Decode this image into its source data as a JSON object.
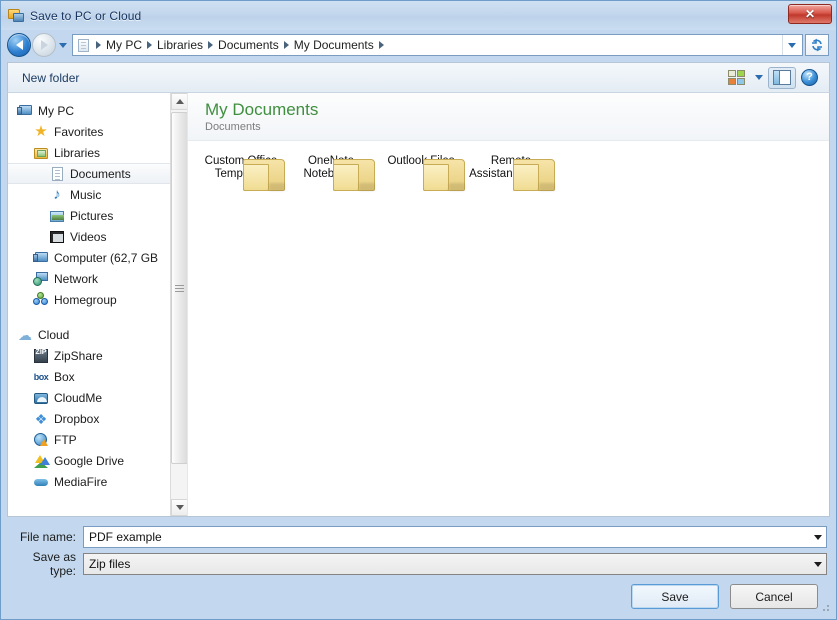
{
  "window": {
    "title": "Save to PC or Cloud",
    "title_icon": "folder-computer-icon",
    "close_label": "✕"
  },
  "address_bar": {
    "back_icon": "back-arrow-icon",
    "forward_icon": "forward-arrow-icon",
    "history_icon": "chevron-down-icon",
    "path_icon": "documents-icon",
    "crumbs": [
      "My PC",
      "Libraries",
      "Documents",
      "My Documents"
    ],
    "separator": "›",
    "dropdown_icon": "chevron-down-icon",
    "refresh_icon": "refresh-icon"
  },
  "toolbar": {
    "new_folder_label": "New folder",
    "views_icon": "views-grid-icon",
    "views_caret_icon": "chevron-down-icon",
    "preview_pane_icon": "preview-pane-icon",
    "help_icon": "help-icon",
    "help_glyph": "?"
  },
  "sidebar": {
    "items": [
      {
        "label": "My PC",
        "icon": "computer-icon",
        "indent": 0,
        "selected": false
      },
      {
        "label": "Favorites",
        "icon": "star-icon",
        "indent": 1,
        "selected": false
      },
      {
        "label": "Libraries",
        "icon": "libraries-icon",
        "indent": 1,
        "selected": false
      },
      {
        "label": "Documents",
        "icon": "documents-icon",
        "indent": 2,
        "selected": true
      },
      {
        "label": "Music",
        "icon": "music-icon",
        "indent": 2,
        "selected": false
      },
      {
        "label": "Pictures",
        "icon": "pictures-icon",
        "indent": 2,
        "selected": false
      },
      {
        "label": "Videos",
        "icon": "videos-icon",
        "indent": 2,
        "selected": false
      },
      {
        "label": "Computer (62,7 GB",
        "icon": "computer-drive-icon",
        "indent": 1,
        "selected": false
      },
      {
        "label": "Network",
        "icon": "network-icon",
        "indent": 1,
        "selected": false
      },
      {
        "label": "Homegroup",
        "icon": "homegroup-icon",
        "indent": 1,
        "selected": false
      }
    ],
    "cloud_items": [
      {
        "label": "Cloud",
        "icon": "cloud-icon",
        "indent": 0,
        "selected": false
      },
      {
        "label": "ZipShare",
        "icon": "zipshare-icon",
        "indent": 1,
        "selected": false
      },
      {
        "label": "Box",
        "icon": "box-icon",
        "indent": 1,
        "selected": false
      },
      {
        "label": "CloudMe",
        "icon": "cloudme-icon",
        "indent": 1,
        "selected": false
      },
      {
        "label": "Dropbox",
        "icon": "dropbox-icon",
        "indent": 1,
        "selected": false
      },
      {
        "label": "FTP",
        "icon": "ftp-icon",
        "indent": 1,
        "selected": false
      },
      {
        "label": "Google Drive",
        "icon": "google-drive-icon",
        "indent": 1,
        "selected": false
      },
      {
        "label": "MediaFire",
        "icon": "mediafire-icon",
        "indent": 1,
        "selected": false
      }
    ],
    "scroll_up_icon": "triangle-up-icon",
    "scroll_down_icon": "triangle-down-icon"
  },
  "content": {
    "title": "My Documents",
    "subtitle": "Documents",
    "title_color": "#3f8f3f",
    "folders": [
      {
        "name": "Custom Office Templates",
        "icon": "folder-icon"
      },
      {
        "name": "OneNote Notebooks",
        "icon": "folder-icon"
      },
      {
        "name": "Outlook Files",
        "icon": "folder-icon"
      },
      {
        "name": "Remote Assistance Logs",
        "icon": "folder-icon"
      }
    ]
  },
  "form": {
    "file_name_label": "File name:",
    "file_name_value": "PDF example",
    "save_as_type_label": "Save as type:",
    "save_as_type_value": "Zip files",
    "dropdown_icon": "chevron-down-icon"
  },
  "buttons": {
    "save_label": "Save",
    "cancel_label": "Cancel"
  }
}
